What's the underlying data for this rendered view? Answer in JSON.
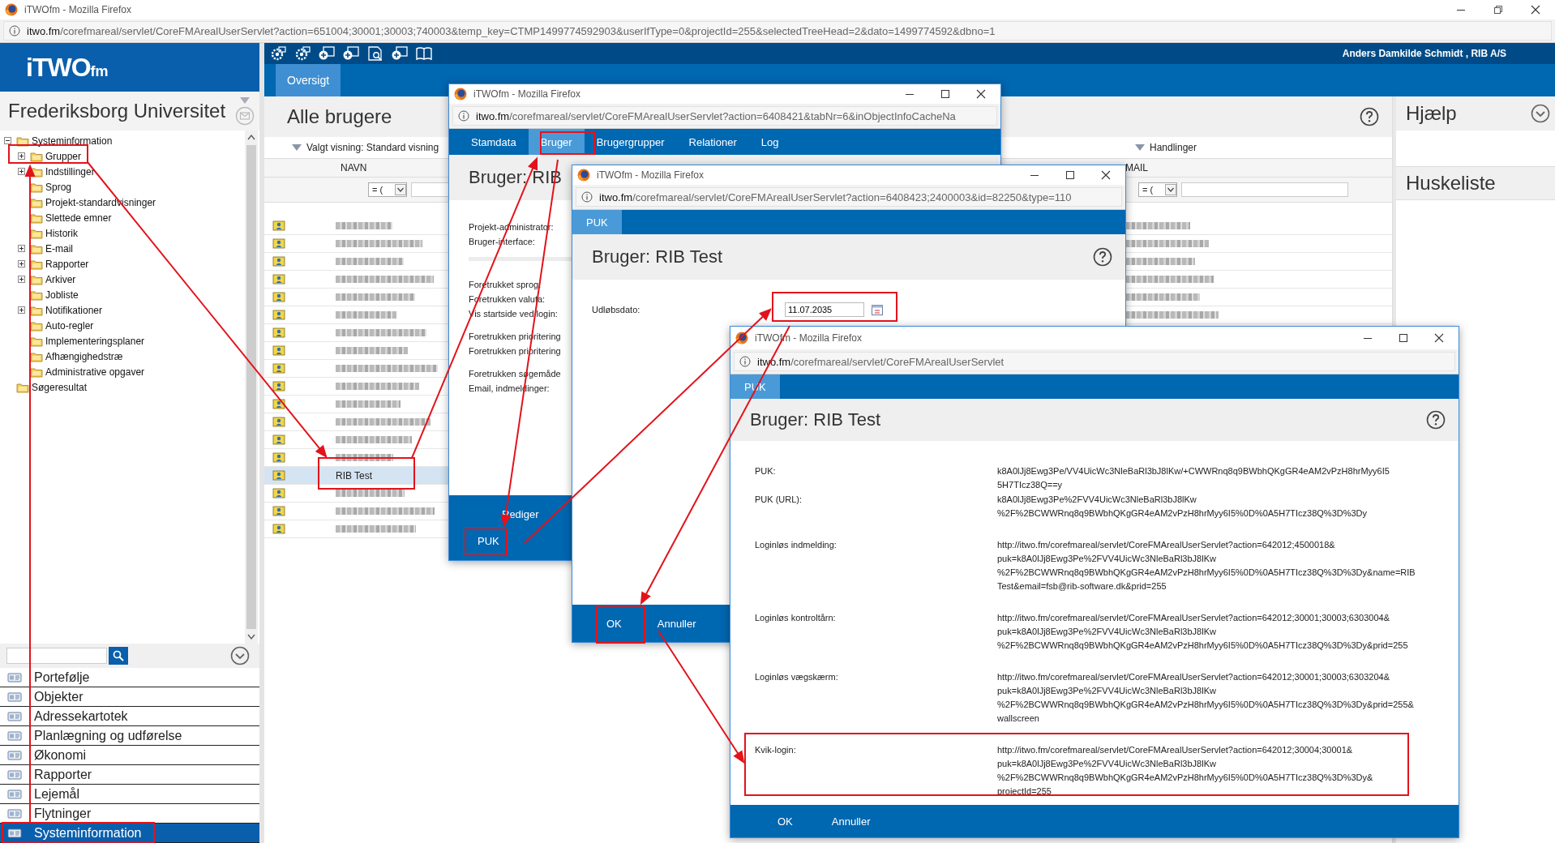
{
  "browser": {
    "title": "iTWOfm - Mozilla Firefox",
    "url_host": "itwo.fm",
    "url_path": "/corefmareal/servlet/CoreFMArealUserServlet?action=651004;30001;30003;740003&temp_key=CTMP1499774592903&userIfType=0&projectId=255&selectedTreeHead=2&dato=1499774592&dbno=1"
  },
  "sidebar": {
    "logo": {
      "main": "iTWO",
      "sub": "fm"
    },
    "project": "Frederiksborg Universitet",
    "tree": [
      {
        "label": "Systeminformation",
        "expanded": true,
        "children": [
          {
            "label": "Grupper",
            "expanded": false
          },
          {
            "label": "Indstillinger",
            "expanded": false
          },
          {
            "label": "Sprog"
          },
          {
            "label": "Projekt-standardvisninger"
          },
          {
            "label": "Slettede emner"
          },
          {
            "label": "Historik"
          },
          {
            "label": "E-mail",
            "expanded": false
          },
          {
            "label": "Rapporter",
            "expanded": false
          },
          {
            "label": "Arkiver",
            "expanded": false
          },
          {
            "label": "Jobliste"
          },
          {
            "label": "Notifikationer",
            "expanded": false
          },
          {
            "label": "Auto-regler"
          },
          {
            "label": "Implementeringsplaner"
          },
          {
            "label": "Afhængighedstræ"
          },
          {
            "label": "Administrative opgaver"
          }
        ]
      },
      {
        "label": "Søgeresultat"
      }
    ],
    "modules": [
      {
        "label": "Portefølje",
        "selected": false
      },
      {
        "label": "Objekter",
        "selected": false
      },
      {
        "label": "Adressekartotek",
        "selected": false
      },
      {
        "label": "Planlægning og udførelse",
        "selected": false
      },
      {
        "label": "Økonomi",
        "selected": false
      },
      {
        "label": "Rapporter",
        "selected": false
      },
      {
        "label": "Lejemål",
        "selected": false
      },
      {
        "label": "Flytninger",
        "selected": false
      },
      {
        "label": "Systeminformation",
        "selected": true
      }
    ]
  },
  "toolbar": {
    "user": "Anders Damkilde Schmidt , RIB A/S"
  },
  "tabs": [
    {
      "label": "Oversigt",
      "selected": true
    }
  ],
  "list": {
    "title": "Alle brugere",
    "view": "Valgt visning: Standard visning",
    "actions": "Handlinger",
    "columns": [
      "NAVN",
      "MAIL"
    ],
    "filter_op": "= (",
    "rows": [
      {
        "selected": false
      },
      {
        "selected": false
      },
      {
        "selected": false
      },
      {
        "selected": false
      },
      {
        "selected": false
      },
      {
        "selected": false
      },
      {
        "selected": false
      },
      {
        "selected": false
      },
      {
        "selected": false
      },
      {
        "selected": false
      },
      {
        "selected": false
      },
      {
        "selected": false
      },
      {
        "selected": false
      },
      {
        "selected": false
      },
      {
        "name": "RIB Test",
        "selected": true
      },
      {
        "selected": false
      },
      {
        "selected": false
      },
      {
        "selected": false
      }
    ]
  },
  "help_panel": {
    "title": "Hjælp",
    "bookmarks": "Huskeliste"
  },
  "dialogs": [
    {
      "kind": "profile",
      "title": "iTWOfm - Mozilla Firefox",
      "url_host": "itwo.fm",
      "url_path": "/corefmareal/servlet/CoreFMArealUserServlet?action=6408421&tabNr=6&inObjectInfoCacheNa",
      "tabs": [
        {
          "label": "Stamdata",
          "selected": false
        },
        {
          "label": "Bruger",
          "selected": true
        },
        {
          "label": "Brugergrupper",
          "selected": false
        },
        {
          "label": "Relationer",
          "selected": false
        },
        {
          "label": "Log",
          "selected": false
        }
      ],
      "heading": "Bruger: RIB",
      "label_groups": [
        [
          "Projekt-administrator:",
          "Bruger-interface:"
        ],
        [
          "Foretrukket sprog:",
          "Foretrukken valuta:",
          "Vis startside ved login:"
        ],
        [
          "Foretrukken prioritering",
          "Foretrukken prioritering"
        ],
        [
          "Foretrukken søgemåde",
          "Email, indmeldinger:"
        ]
      ],
      "buttons": [
        "Rediger",
        "PUK"
      ]
    },
    {
      "kind": "expiry",
      "title": "iTWOfm - Mozilla Firefox",
      "url_host": "itwo.fm",
      "url_path": "/corefmareal/servlet/CoreFMArealUserServlet?action=6408423;2400003&id=82250&type=110",
      "tabs": [
        {
          "label": "PUK",
          "selected": true
        }
      ],
      "heading": "Bruger: RIB Test",
      "field": {
        "label": "Udløbsdato:",
        "value": "11.07.2035"
      },
      "buttons": [
        "OK",
        "Annuller"
      ]
    },
    {
      "kind": "puk",
      "title": "iTWOfm - Mozilla Firefox",
      "url_host": "itwo.fm",
      "url_path": "/corefmareal/servlet/CoreFMArealUserServlet",
      "tabs": [
        {
          "label": "PUK",
          "selected": true
        }
      ],
      "heading": "Bruger: RIB Test",
      "rows": [
        {
          "label": "PUK:",
          "value": "k8A0lJj8Ewg3Pe/VV4UicWc3NleBaRl3bJ8lKw/+CWWRnq8q9BWbhQKgGR4eAM2vPzH8hrMyy6I5\n5H7TIcz38Q==y"
        },
        {
          "label": "PUK (URL):",
          "value": "k8A0lJj8Ewg3Pe%2FVV4UicWc3NleBaRl3bJ8lKw\n%2F%2BCWWRnq8q9BWbhQKgGR4eAM2vPzH8hrMyy6I5%0D%0A5H7TIcz38Q%3D%3Dy"
        },
        {
          "label": "Loginløs indmelding:",
          "value": "http://itwo.fm/corefmareal/servlet/CoreFMArealUserServlet?action=642012;4500018&\npuk=k8A0lJj8Ewg3Pe%2FVV4UicWc3NleBaRl3bJ8lKw\n%2F%2BCWWRnq8q9BWbhQKgGR4eAM2vPzH8hrMyy6I5%0D%0A5H7TIcz38Q%3D%3Dy&name=RIB\nTest&email=fsb@rib-software.dk&prid=255"
        },
        {
          "label": "Loginløs kontroltårn:",
          "value": "http://itwo.fm/corefmareal/servlet/CoreFMArealUserServlet?action=642012;30001;30003;6303004&\npuk=k8A0lJj8Ewg3Pe%2FVV4UicWc3NleBaRl3bJ8lKw\n%2F%2BCWWRnq8q9BWbhQKgGR4eAM2vPzH8hrMyy6I5%0D%0A5H7TIcz38Q%3D%3Dy&prid=255"
        },
        {
          "label": "Loginløs vægskærm:",
          "value": "http://itwo.fm/corefmareal/servlet/CoreFMArealUserServlet?action=642012;30001;30003;6303204&\npuk=k8A0lJj8Ewg3Pe%2FVV4UicWc3NleBaRl3bJ8lKw\n%2F%2BCWWRnq8q9BWbhQKgGR4eAM2vPzH8hrMyy6I5%0D%0A5H7TIcz38Q%3D%3Dy&prid=255&\nwallscreen"
        },
        {
          "label": "Kvik-login:",
          "value": "http://itwo.fm/corefmareal/servlet/CoreFMArealUserServlet?action=642012;30004;30001&\npuk=k8A0lJj8Ewg3Pe%2FVV4UicWc3NleBaRl3bJ8lKw\n%2F%2BCWWRnq8q9BWbhQKgGR4eAM2vPzH8hrMyy6I5%0D%0A5H7TIcz38Q%3D%3Dy&\nprojectId=255"
        }
      ],
      "buttons": [
        "OK",
        "Annuller"
      ]
    }
  ]
}
